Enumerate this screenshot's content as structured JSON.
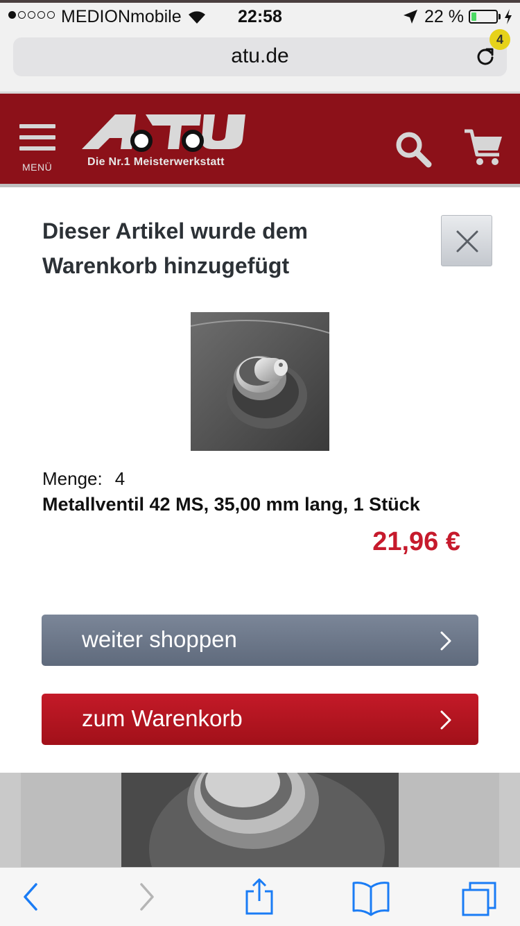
{
  "status_bar": {
    "carrier": "MEDIONmobile",
    "time": "22:58",
    "battery_percent": "22 %",
    "battery_level": 0.22,
    "signal_bars": 1,
    "icons": [
      "wifi-icon",
      "location-arrow-icon",
      "battery-icon",
      "charging-bolt-icon"
    ]
  },
  "browser": {
    "url": "atu.de",
    "reload_icon": "reload-icon"
  },
  "header": {
    "menu_label": "MENÜ",
    "logo_text": "ATU",
    "tagline": "Die Nr.1 Meisterwerkstatt",
    "cart_count": "4",
    "brand_color": "#8c1119",
    "badge_color": "#e6d21a"
  },
  "modal": {
    "title": "Dieser Artikel wurde dem Warenkorb hinzugefügt",
    "close_icon": "close-icon",
    "quantity_label": "Menge:",
    "quantity_value": "4",
    "product_name": "Metallventil 42 MS, 35,00 mm lang, 1 Stück",
    "price": "21,96 €",
    "price_color": "#c61a2c",
    "continue_button": "weiter shoppen",
    "cart_button": "zum Warenkorb"
  },
  "toolbar": {
    "icons": [
      "back-icon",
      "forward-icon",
      "share-icon",
      "bookmarks-icon",
      "tabs-icon"
    ]
  }
}
